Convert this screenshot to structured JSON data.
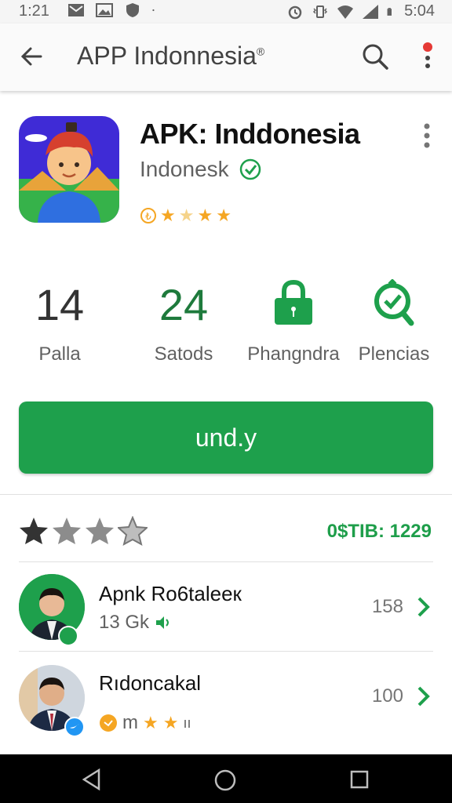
{
  "status_bar": {
    "time": "1:21",
    "battery_text": "5:04"
  },
  "app_bar": {
    "title": "APP Indonnesia",
    "title_mark": "®"
  },
  "app": {
    "name": "APK: Inddonesia",
    "developer": "Indonesk",
    "rating_icons": [
      "coin-icon",
      "star",
      "half-star",
      "star",
      "star"
    ]
  },
  "stats": [
    {
      "value": "14",
      "label": "Palla"
    },
    {
      "value": "24",
      "label": "Satods"
    },
    {
      "icon": "lock-icon",
      "label": "Phangndra"
    },
    {
      "icon": "magnifier-check-icon",
      "label": "Plencias"
    }
  ],
  "install_button": {
    "label": "und.y"
  },
  "rating_summary": {
    "count_text": "0$TIB: 1229",
    "filled_stars": 1,
    "total_stars": 4
  },
  "reviews": [
    {
      "name": "Apnk Ro6talеeк",
      "meta": "13 Gk",
      "count": "158"
    },
    {
      "name": "Rıdoncakal",
      "meta": "m",
      "count": "100"
    }
  ],
  "colors": {
    "accent": "#1ea04c",
    "star": "#f5a623",
    "text_primary": "#111111"
  }
}
